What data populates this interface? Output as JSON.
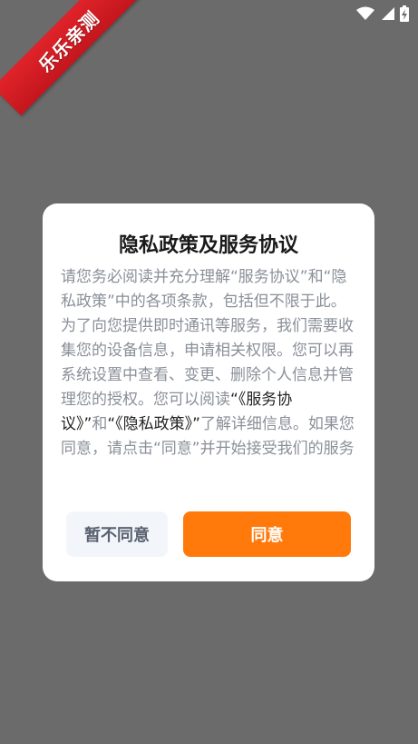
{
  "watermark": {
    "text": "乐乐亲测"
  },
  "dialog": {
    "title": "隐私政策及服务协议",
    "body": {
      "part1": "请您务必阅读并充分理解“服务协议”和“隐私政策”中的各项条款，包括但不限于此。为了向您提供即时通讯等服务，我们需要收集您的设备信息，申请相关权限。您可以再系统设置中查看、变更、删除个人信息并管理您的授权。您可以阅读",
      "link_service": "“《服务协议》”",
      "and": "和",
      "link_privacy": "“《隐私政策》”",
      "part2": "了解详细信息。如果您同意，请点击“同意”并开始接受我们的服务"
    },
    "decline_label": "暂不同意",
    "accept_label": "同意"
  },
  "colors": {
    "overlay": "#6b6b6b",
    "accent": "#ff7a0b",
    "decline_bg": "#f2f6fb",
    "ribbon": "#d41c22"
  },
  "status_icons": [
    "wifi-icon",
    "signal-icon",
    "battery-charging-icon"
  ]
}
